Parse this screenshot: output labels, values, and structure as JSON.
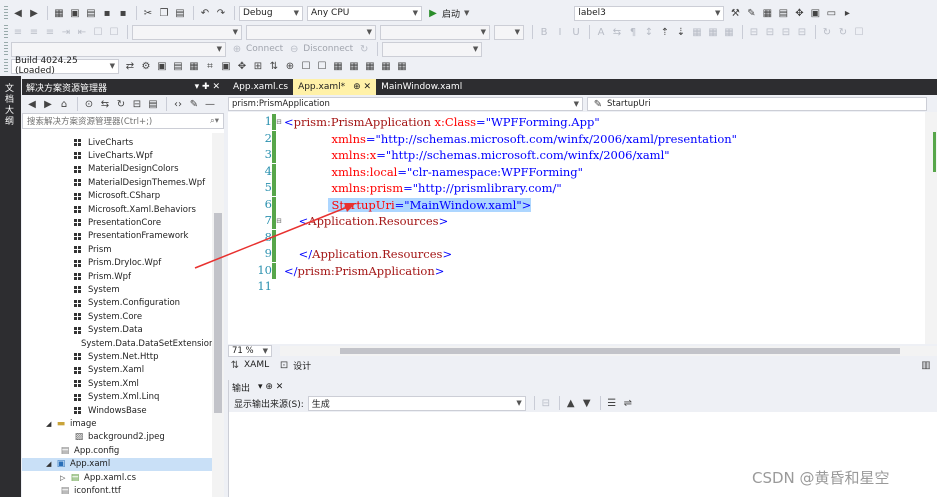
{
  "toolbar1": {
    "config": "Debug",
    "platform": "Any CPU",
    "start_label": "启动",
    "label_target": "label3"
  },
  "toolbar2": {
    "connect_label": "Connect",
    "disconnect_label": "Disconnect"
  },
  "toolbar3": {
    "build": "Build 4024.25 (Loaded)"
  },
  "left_strip": {
    "label": "文档大纲"
  },
  "solution_explorer": {
    "title": "解决方案资源管理器",
    "title_icons": "▾ ✚ ✕",
    "search_placeholder": "搜索解决方案资源管理器(Ctrl+;)",
    "references": [
      "LiveCharts",
      "LiveCharts.Wpf",
      "MaterialDesignColors",
      "MaterialDesignThemes.Wpf",
      "Microsoft.CSharp",
      "Microsoft.Xaml.Behaviors",
      "PresentationCore",
      "PresentationFramework",
      "Prism",
      "Prism.DryIoc.Wpf",
      "Prism.Wpf",
      "System",
      "System.Configuration",
      "System.Core",
      "System.Data",
      "System.Data.DataSetExtensions",
      "System.Net.Http",
      "System.Xaml",
      "System.Xml",
      "System.Xml.Linq",
      "WindowsBase"
    ],
    "folder_image": "image",
    "image_file": "background2.jpeg",
    "app_config": "App.config",
    "app_xaml": "App.xaml",
    "app_xaml_cs": "App.xaml.cs",
    "iconfont": "iconfont.ttf"
  },
  "tabs": [
    {
      "label": "App.xaml.cs",
      "active": false
    },
    {
      "label": "App.xaml*",
      "active": true
    },
    {
      "label": "MainWindow.xaml",
      "active": false
    }
  ],
  "tab_pin": "⊕ ✕",
  "navbar": {
    "left": "prism:PrismApplication",
    "right": "StartupUri"
  },
  "code_lines": [
    {
      "n": "1",
      "parts": [
        [
          "pun",
          "<"
        ],
        [
          "tag",
          "prism:PrismApplication"
        ],
        [
          "attr",
          " x:Class"
        ],
        [
          "pun",
          "="
        ],
        [
          "val",
          "\"WPFForming.App\""
        ]
      ]
    },
    {
      "n": "2",
      "parts": [
        [
          "attr",
          "             xmlns"
        ],
        [
          "pun",
          "="
        ],
        [
          "val",
          "\"http://schemas.microsoft.com/winfx/2006/xaml/presentation\""
        ]
      ]
    },
    {
      "n": "3",
      "parts": [
        [
          "attr",
          "             xmlns:x"
        ],
        [
          "pun",
          "="
        ],
        [
          "val",
          "\"http://schemas.microsoft.com/winfx/2006/xaml\""
        ]
      ]
    },
    {
      "n": "4",
      "parts": [
        [
          "attr",
          "             xmlns:local"
        ],
        [
          "pun",
          "="
        ],
        [
          "val",
          "\"clr-namespace:WPFForming\""
        ]
      ]
    },
    {
      "n": "5",
      "parts": [
        [
          "attr",
          "             xmlns:prism"
        ],
        [
          "pun",
          "="
        ],
        [
          "val",
          "\"http://prismlibrary.com/\""
        ]
      ]
    },
    {
      "n": "6",
      "parts": [
        [
          "attr",
          "             StartupUri"
        ],
        [
          "pun",
          "="
        ],
        [
          "val",
          "\"MainWindow.xaml\""
        ],
        [
          "pun",
          ">"
        ]
      ]
    },
    {
      "n": "7",
      "parts": [
        [
          "pun",
          "    <"
        ],
        [
          "tag",
          "Application.Resources"
        ],
        [
          "pun",
          ">"
        ]
      ]
    },
    {
      "n": "8",
      "parts": []
    },
    {
      "n": "9",
      "parts": [
        [
          "pun",
          "    </"
        ],
        [
          "tag",
          "Application.Resources"
        ],
        [
          "pun",
          ">"
        ]
      ]
    },
    {
      "n": "10",
      "parts": [
        [
          "pun",
          "</"
        ],
        [
          "tag",
          "prism:PrismApplication"
        ],
        [
          "pun",
          ">"
        ]
      ]
    },
    {
      "n": "11",
      "parts": []
    }
  ],
  "zoom": "71 %",
  "view": {
    "xaml": "XAML",
    "design": "设计"
  },
  "output": {
    "title": "输出",
    "title_icons": "▾ ⊕ ✕",
    "source_label": "显示输出来源(S):",
    "source_value": "生成"
  },
  "watermark": "CSDN @黄昏和星空",
  "colors": {
    "highlight": "#add6ff",
    "arrow": "#e8312f",
    "active_tab": "#fff1a8"
  }
}
